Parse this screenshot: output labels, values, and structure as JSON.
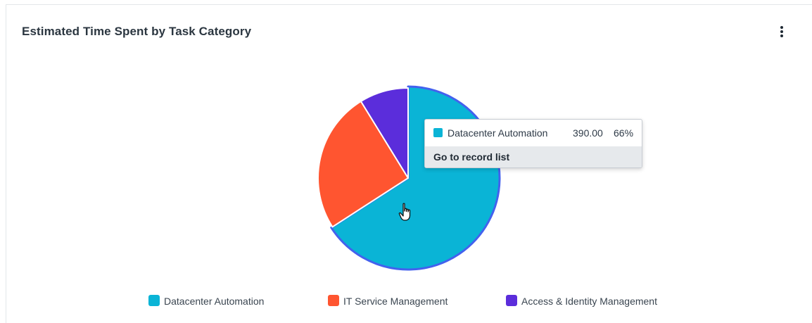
{
  "card": {
    "title": "Estimated Time Spent by Task Category",
    "menu_icon": "more-vertical-icon"
  },
  "chart_data": {
    "type": "pie",
    "title": "Estimated Time Spent by Task Category",
    "categories": [
      "Datacenter Automation",
      "IT Service Management",
      "Access & Identity Management"
    ],
    "values": [
      390.0,
      150.0,
      52.0
    ],
    "colors": [
      "#0ab4d6",
      "#ff5530",
      "#5b2ddb"
    ],
    "highlight_index": 0,
    "highlight_stroke": "#4361ee",
    "legend_position": "bottom"
  },
  "tooltip": {
    "label": "Datacenter Automation",
    "value": "390.00",
    "percent": "66%",
    "link_label": "Go to record list"
  },
  "legend": [
    {
      "label": "Datacenter Automation",
      "color": "#0ab4d6"
    },
    {
      "label": "IT Service Management",
      "color": "#ff5530"
    },
    {
      "label": "Access & Identity Management",
      "color": "#5b2ddb"
    }
  ],
  "cursor": {
    "icon": "hand-pointer-icon"
  }
}
